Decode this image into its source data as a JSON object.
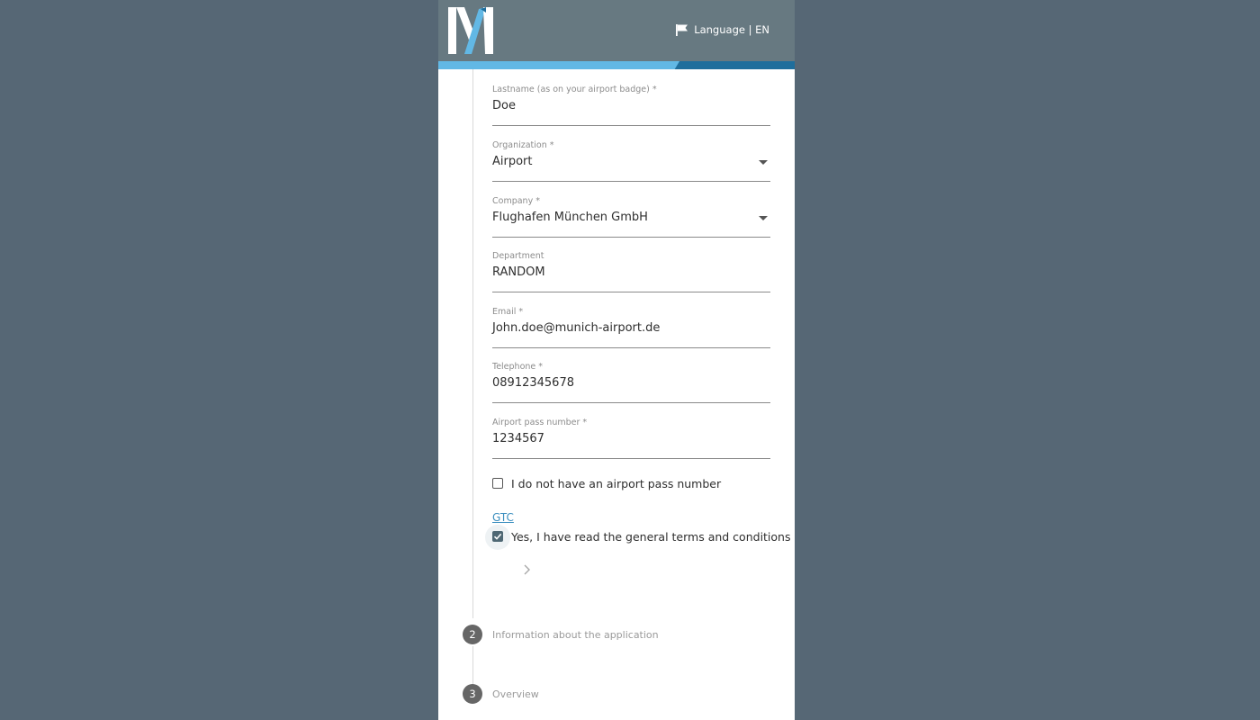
{
  "header": {
    "language_label": "Language | EN",
    "brand_colors": {
      "light": "#62b8e5",
      "dark": "#1f6e9c"
    }
  },
  "form": {
    "lastname": {
      "label": "Lastname (as on your airport badge) *",
      "value": "Doe"
    },
    "organization": {
      "label": "Organization *",
      "value": "Airport"
    },
    "company": {
      "label": "Company *",
      "value": "Flughafen München GmbH"
    },
    "department": {
      "label": "Department",
      "value": "RANDOM"
    },
    "email": {
      "label": "Email *",
      "value": "John.doe@munich-airport.de"
    },
    "telephone": {
      "label": "Telephone *",
      "value": "08912345678"
    },
    "airport_pass": {
      "label": "Airport pass number *",
      "value": "1234567"
    },
    "no_pass_checkbox": {
      "label": "I do not have an airport pass number",
      "checked": false
    },
    "gtc_link": "GTC",
    "gtc_checkbox": {
      "label": "Yes, I have read the general terms and conditions a",
      "checked": true
    }
  },
  "steps": [
    {
      "number": "2",
      "title": "Information about the application"
    },
    {
      "number": "3",
      "title": "Overview"
    }
  ]
}
